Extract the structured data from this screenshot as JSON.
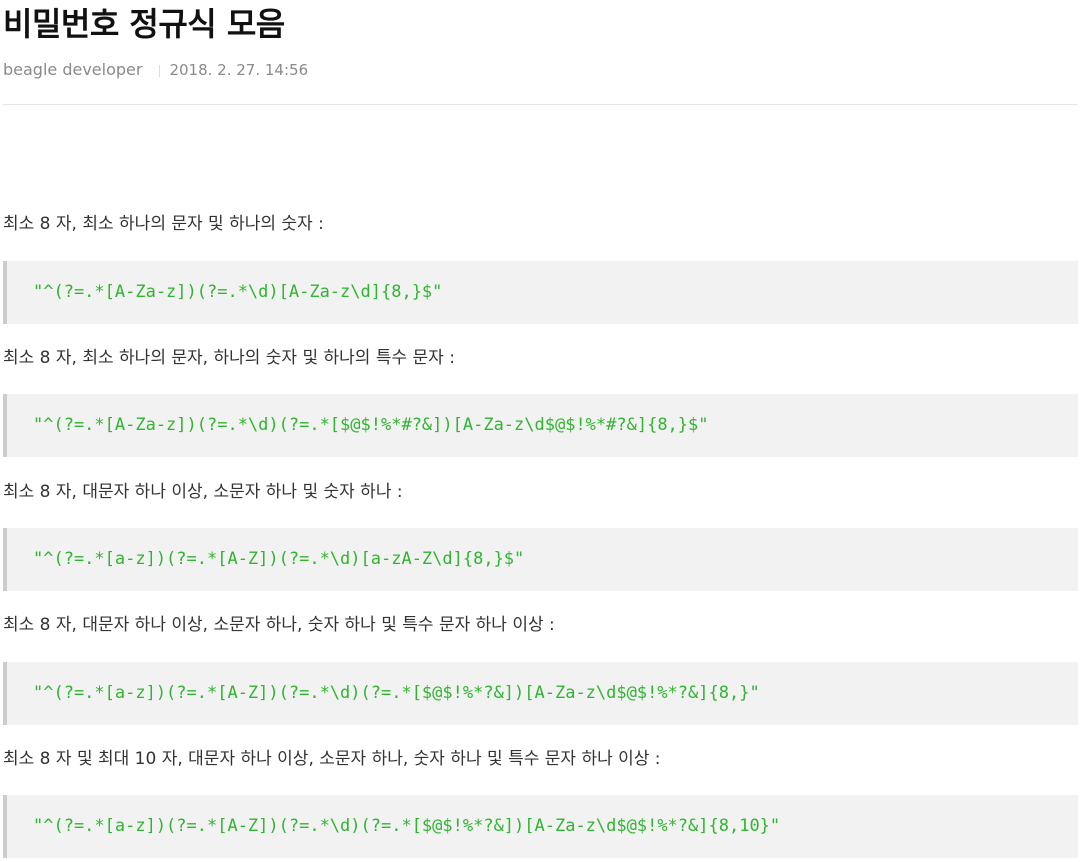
{
  "post": {
    "title": "비밀번호 정규식 모음",
    "author": "beagle developer",
    "date": "2018. 2. 27. 14:56"
  },
  "sections": [
    {
      "description": "최소 8 자, 최소 하나의 문자 및 하나의 숫자 :",
      "regex": "\"^(?=.*[A-Za-z])(?=.*\\d)[A-Za-z\\d]{8,}$\""
    },
    {
      "description": "최소 8 자, 최소 하나의 문자, 하나의 숫자 및 하나의 특수 문자 :",
      "regex": "\"^(?=.*[A-Za-z])(?=.*\\d)(?=.*[$@$!%*#?&])[A-Za-z\\d$@$!%*#?&]{8,}$\""
    },
    {
      "description": "최소 8 자, 대문자 하나 이상, 소문자 하나 및 숫자 하나 :",
      "regex": "\"^(?=.*[a-z])(?=.*[A-Z])(?=.*\\d)[a-zA-Z\\d]{8,}$\""
    },
    {
      "description": "최소 8 자, 대문자 하나 이상, 소문자 하나, 숫자 하나 및 특수 문자 하나 이상 :",
      "regex": "\"^(?=.*[a-z])(?=.*[A-Z])(?=.*\\d)(?=.*[$@$!%*?&])[A-Za-z\\d$@$!%*?&]{8,}\""
    },
    {
      "description": "최소 8 자 및 최대 10 자, 대문자 하나 이상, 소문자 하나, 숫자 하나 및 특수 문자 하나 이상 :",
      "regex": "\"^(?=.*[a-z])(?=.*[A-Z])(?=.*\\d)(?=.*[$@$!%*?&])[A-Za-z\\d$@$!%*?&]{8,10}\""
    }
  ],
  "colors": {
    "code_text": "#2fb52f",
    "code_background": "#f2f2f2",
    "code_border": "#cccccc"
  }
}
